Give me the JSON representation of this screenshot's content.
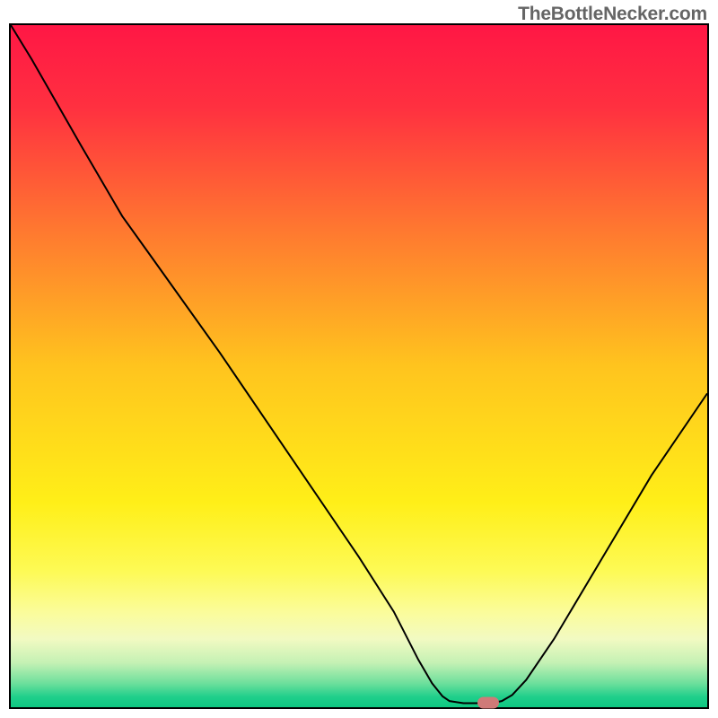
{
  "attribution": "TheBottleNecker.com",
  "chart_data": {
    "type": "line",
    "title": "",
    "xlabel": "",
    "ylabel": "",
    "xlim": [
      0,
      100
    ],
    "ylim": [
      0,
      100
    ],
    "gradient_stops": [
      {
        "pos": 0.0,
        "color": "#ff1745"
      },
      {
        "pos": 0.12,
        "color": "#ff3040"
      },
      {
        "pos": 0.3,
        "color": "#ff7830"
      },
      {
        "pos": 0.5,
        "color": "#ffc41e"
      },
      {
        "pos": 0.7,
        "color": "#ffef18"
      },
      {
        "pos": 0.8,
        "color": "#fdfa55"
      },
      {
        "pos": 0.86,
        "color": "#fbfc9a"
      },
      {
        "pos": 0.9,
        "color": "#f2fac2"
      },
      {
        "pos": 0.935,
        "color": "#c4f1b4"
      },
      {
        "pos": 0.965,
        "color": "#6ddf9c"
      },
      {
        "pos": 0.985,
        "color": "#1fcf8b"
      },
      {
        "pos": 1.0,
        "color": "#0fc882"
      }
    ],
    "series": [
      {
        "name": "bottleneck-curve",
        "points": [
          {
            "x": 0.0,
            "y": 100.0
          },
          {
            "x": 3.0,
            "y": 95.0
          },
          {
            "x": 10.0,
            "y": 82.5
          },
          {
            "x": 16.0,
            "y": 72.0
          },
          {
            "x": 20.0,
            "y": 66.3
          },
          {
            "x": 30.0,
            "y": 52.0
          },
          {
            "x": 40.0,
            "y": 37.0
          },
          {
            "x": 50.0,
            "y": 22.0
          },
          {
            "x": 55.0,
            "y": 14.0
          },
          {
            "x": 58.5,
            "y": 7.0
          },
          {
            "x": 60.5,
            "y": 3.5
          },
          {
            "x": 62.0,
            "y": 1.6
          },
          {
            "x": 63.0,
            "y": 0.9
          },
          {
            "x": 65.0,
            "y": 0.6
          },
          {
            "x": 67.0,
            "y": 0.6
          },
          {
            "x": 69.0,
            "y": 0.6
          },
          {
            "x": 70.5,
            "y": 0.9
          },
          {
            "x": 72.0,
            "y": 1.8
          },
          {
            "x": 74.0,
            "y": 4.0
          },
          {
            "x": 78.0,
            "y": 10.0
          },
          {
            "x": 85.0,
            "y": 22.0
          },
          {
            "x": 92.0,
            "y": 34.0
          },
          {
            "x": 100.0,
            "y": 46.0
          }
        ]
      }
    ],
    "marker": {
      "x": 68.5,
      "y": 0.6,
      "color": "#cf7a78"
    }
  }
}
